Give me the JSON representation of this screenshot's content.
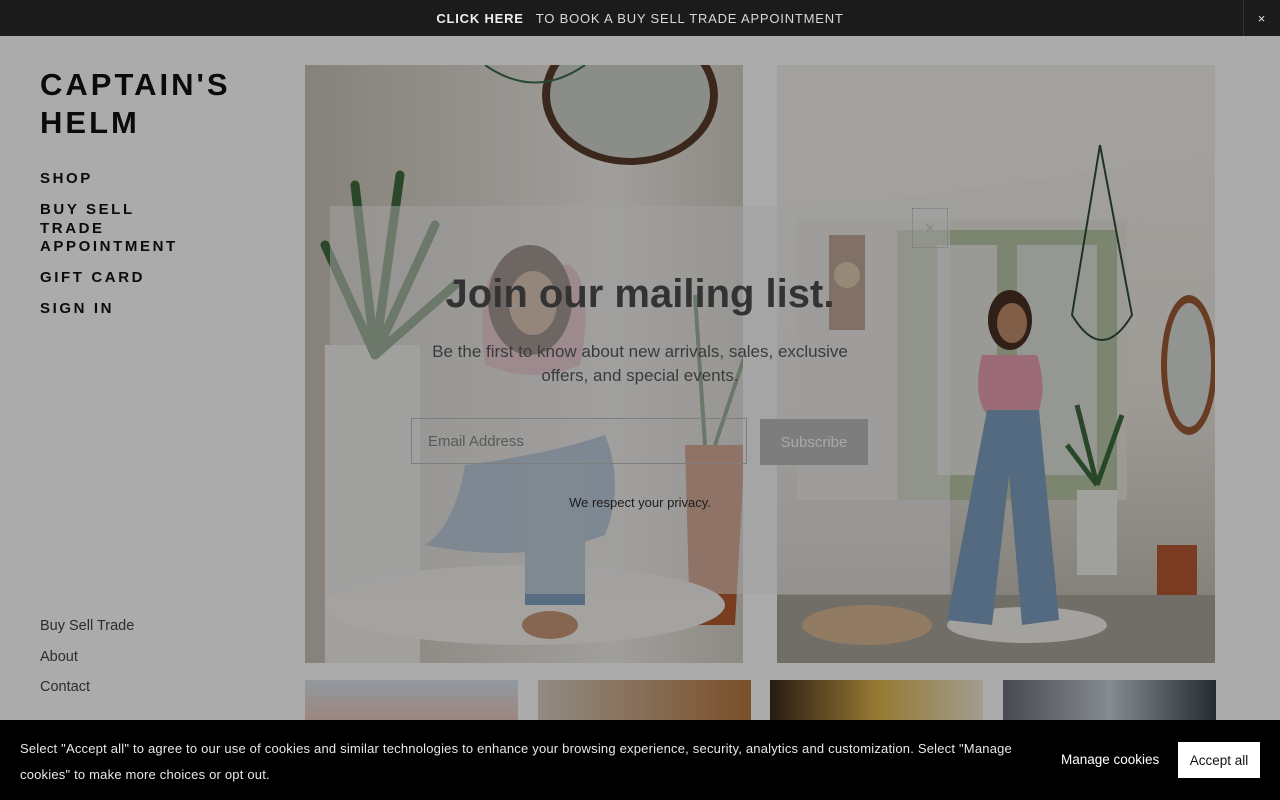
{
  "announcement": {
    "link_text": "CLICK HERE",
    "text": "TO BOOK A BUY SELL TRADE APPOINTMENT",
    "close_label": "×"
  },
  "brand": {
    "line1": "CAPTAIN'S",
    "line2": "HELM"
  },
  "nav": {
    "items": [
      {
        "label": "SHOP"
      },
      {
        "label": "BUY SELL TRADE APPOINTMENT"
      },
      {
        "label": "GIFT CARD"
      },
      {
        "label": "SIGN IN"
      }
    ]
  },
  "footer_links": {
    "items": [
      {
        "label": "Buy Sell Trade"
      },
      {
        "label": "About"
      },
      {
        "label": "Contact"
      }
    ]
  },
  "modal": {
    "title": "Join our mailing list.",
    "description": "Be the first to know about new arrivals, sales, exclusive offers, and special events.",
    "email_placeholder": "Email Address",
    "subscribe_label": "Subscribe",
    "privacy_text": "We respect your privacy.",
    "close_label": "×"
  },
  "cookie_banner": {
    "message": "Select \"Accept all\" to agree to our use of cookies and similar technologies to enhance your browsing experience, security, analytics and customization. Select \"Manage cookies\" to make more choices or opt out.",
    "manage_label": "Manage cookies",
    "accept_label": "Accept all"
  },
  "colors": {
    "announcement_bg": "#1b1b1b",
    "cookie_bg": "#000000",
    "accent_pink": "#e9a0b0",
    "denim": "#7a96b4"
  }
}
